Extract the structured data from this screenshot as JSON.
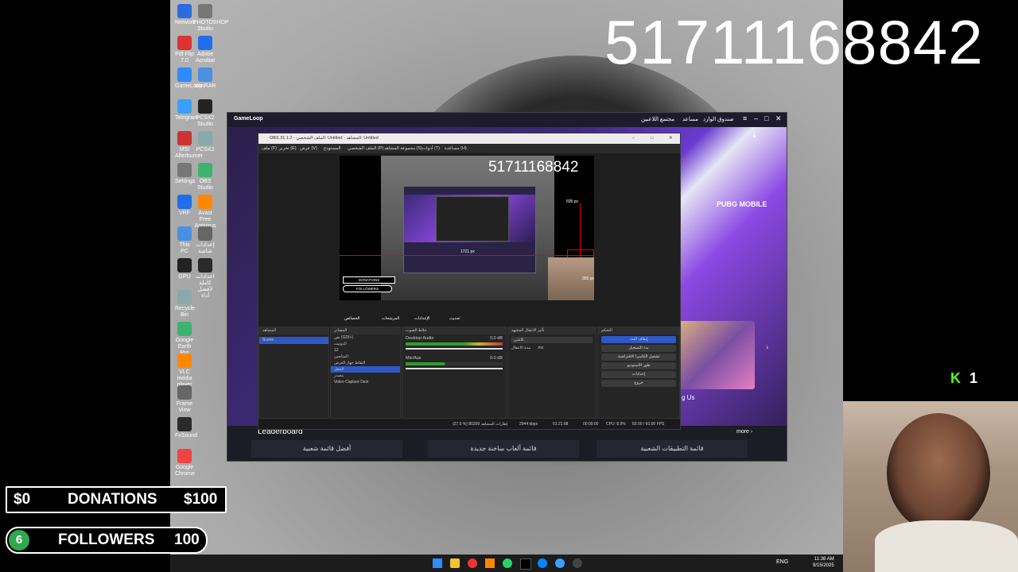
{
  "overlay": {
    "big_counter": "51711168842",
    "donations": {
      "left": "$0",
      "label": "DONATIONS",
      "right": "$100"
    },
    "followers": {
      "count": "6",
      "label": "FOLLOWERS",
      "right": "100"
    },
    "kick_count": "1"
  },
  "desktop_icons": [
    "Network",
    "Pdf Flip 7.0",
    "GameLoop",
    "Telegram",
    "MSI Afterburner",
    "Settings",
    "VRF",
    "This PC",
    "GPU",
    "Recycle Bin",
    "Google Earth Pro",
    "VLC media player",
    "Frame View",
    "FxSound",
    "Google Chrome"
  ],
  "desktop_icons_col2": [
    "PHOTOSHOP Studio",
    "Adobe Acrobat",
    "WinRAR",
    "PCSX2 Studio",
    "PCSX2",
    "OBS Studio",
    "Avast Free Antivirus",
    "إعدادات شاشة",
    "اعدادات كاملة لأفضل أداء"
  ],
  "gameloop": {
    "logo": "GameLoop",
    "title_links": [
      "صندوق الوارد",
      "مساعد",
      "مجتمع اللاعبين"
    ],
    "game_title": "PUBG MOBILE",
    "leaderboard": "Leaderboard",
    "more": "more ›",
    "tabs": [
      "أفضل قائمة شعبية",
      "قائمة ألعاب ساخنة جديدة",
      "قائمة التطبيقات الشعبية"
    ],
    "side_text": "g Us"
  },
  "obs": {
    "title": "OBS 31.1.2 - الملف الشخصي: Untitled - المشاهد: Untitled",
    "menu": [
      "ملف (F)",
      "تحرير (E)",
      "عرض (V)",
      "المستودع",
      "الملف الشخصي (P)",
      "مجموعة المشاهد (S)",
      "أدوات (T)",
      "مساعدة (H)"
    ],
    "preview": {
      "counter": "51711168842",
      "height_label": "695 px",
      "width_label": "1721 px",
      "size_label": "265 px",
      "donations": "DONATIONS",
      "followers": "FOLLOWERS"
    },
    "toolbar": [
      "الخصائص",
      "المرشحات",
      "الإعدادات",
      "تحديث"
    ],
    "panels": {
      "scenes": {
        "title": "المشاهد",
        "items": [
          "Scene"
        ]
      },
      "sources": {
        "title": "المصادر",
        "items": [
          "نص (GDI+)",
          "الدونيت",
          "12",
          "المتابعين",
          "التقاط جهاز العرض",
          "التنقل",
          "مصدر",
          "Video Capture Devi"
        ]
      },
      "mixer": {
        "title": "خلاط الصوت",
        "tracks": [
          {
            "name": "Desktop Audio",
            "db": "0.0 dB"
          },
          {
            "name": "Mic/Aux",
            "db": "0.0 dB"
          }
        ]
      },
      "transitions": {
        "title": "تأثير الانتقال المشهد",
        "type": "تلاشي",
        "duration_label": "مدة الانتقال",
        "duration": "ms"
      },
      "controls": {
        "title": "التحكم",
        "buttons": [
          "إيقاف البث",
          "بدء التسجيل",
          "تشغيل الكاميرا الافتراضية",
          "طور الأستوديو",
          "إعدادات",
          "خروج"
        ]
      }
    },
    "status": {
      "frames": "(27.5 %) 80209 إطارات المشاهد",
      "bitrate": "2944 kbps",
      "time": "01:21:08",
      "rec_time": "00:00:00",
      "cpu": "CPU: 8.9%",
      "fps": "60.00 / 60.00 FPS"
    }
  },
  "taskbar": {
    "lang": "ENG",
    "time": "11:38 AM",
    "date": "9/15/2025"
  }
}
